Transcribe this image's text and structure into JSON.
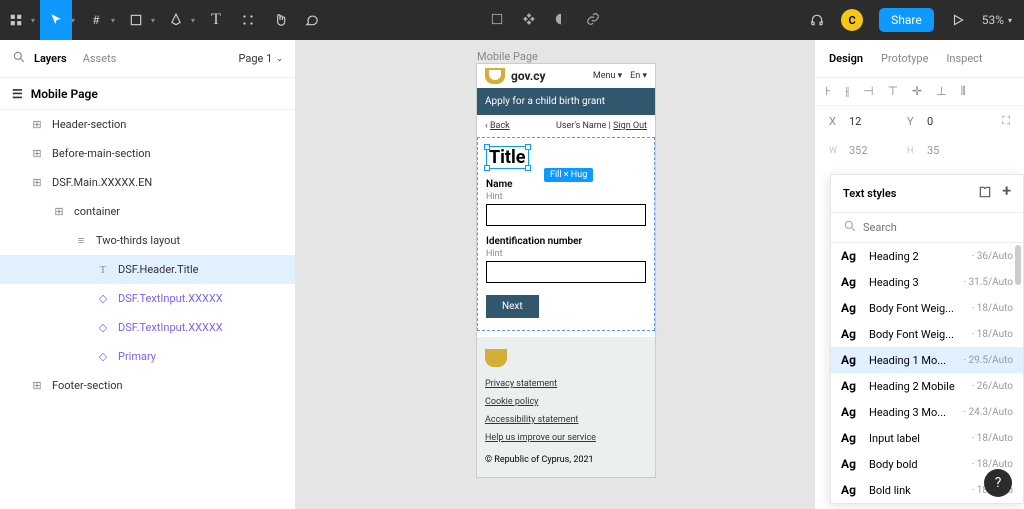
{
  "toolbar": {
    "share": "Share",
    "zoom": "53%",
    "avatar": "C"
  },
  "leftPanel": {
    "tabs": {
      "layers": "Layers",
      "assets": "Assets"
    },
    "pageSelector": "Page 1",
    "pageName": "Mobile Page",
    "layers": [
      {
        "name": "Header-section"
      },
      {
        "name": "Before-main-section"
      },
      {
        "name": "DSF.Main.XXXXX.EN"
      },
      {
        "name": "container"
      },
      {
        "name": "Two-thirds layout"
      },
      {
        "name": "DSF.Header.Title"
      },
      {
        "name": "DSF.TextInput.XXXXX"
      },
      {
        "name": "DSF.TextInput.XXXXX"
      },
      {
        "name": "Primary"
      },
      {
        "name": "Footer-section"
      }
    ]
  },
  "canvas": {
    "frameLabel": "Mobile Page",
    "gov": {
      "site": "gov.cy",
      "menu": "Menu",
      "lang": "En",
      "banner": "Apply for a child birth grant",
      "back": "Back",
      "userLabel": "User's Name | ",
      "signOut": "Sign Out",
      "title": "Title",
      "selectionBadge": "Fill × Hug",
      "field1": {
        "label": "Name",
        "hint": "Hint"
      },
      "field2": {
        "label": "Identification number",
        "hint": "Hint"
      },
      "next": "Next",
      "footerLinks": [
        "Privacy statement",
        "Cookie policy",
        "Accessibility statement",
        "Help us improve our service"
      ],
      "copyright": "© Republic of Cyprus, 2021"
    }
  },
  "rightPanel": {
    "tabs": {
      "design": "Design",
      "prototype": "Prototype",
      "inspect": "Inspect"
    },
    "pos": {
      "xLabel": "X",
      "x": "12",
      "yLabel": "Y",
      "y": "0",
      "wLabel": "W",
      "w": "352",
      "hLabel": "H",
      "h": "35"
    }
  },
  "textStyles": {
    "title": "Text styles",
    "searchPlaceholder": "Search",
    "items": [
      {
        "name": "Heading 2",
        "meta": "36/Auto"
      },
      {
        "name": "Heading 3",
        "meta": "31.5/Auto"
      },
      {
        "name": "Body Font Weig...",
        "meta": "18/Auto"
      },
      {
        "name": "Body Font Weig...",
        "meta": "18/Auto"
      },
      {
        "name": "Heading 1 Mo...",
        "meta": "29.5/Auto"
      },
      {
        "name": "Heading 2 Mobile",
        "meta": "26/Auto"
      },
      {
        "name": "Heading 3 Mo...",
        "meta": "24.3/Auto"
      },
      {
        "name": "Input label",
        "meta": "18/Auto"
      },
      {
        "name": "Body bold",
        "meta": "18/Auto"
      },
      {
        "name": "Bold link",
        "meta": "18/Auto"
      }
    ]
  }
}
